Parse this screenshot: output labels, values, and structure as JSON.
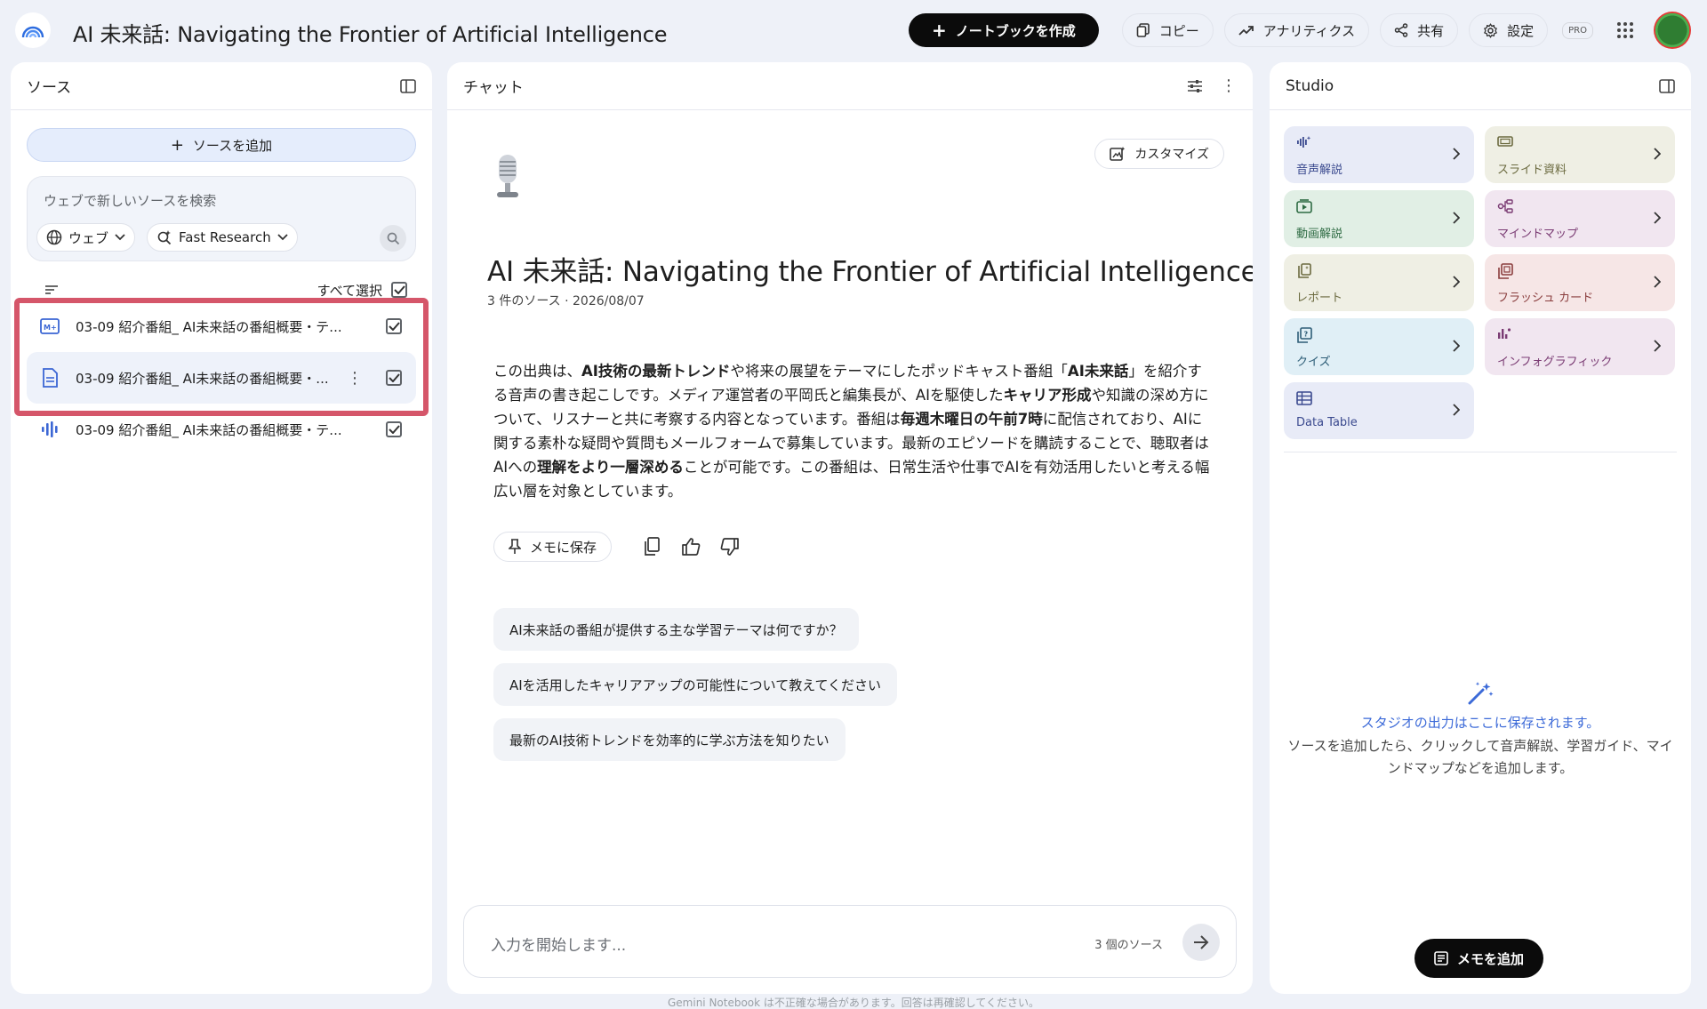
{
  "topbar": {
    "title": "AI 未来話: Navigating the Frontier of Artificial Intelligence",
    "create_label": "ノートブックを作成",
    "copy_label": "コピー",
    "analytics_label": "アナリティクス",
    "share_label": "共有",
    "settings_label": "設定",
    "pro_label": "PRO"
  },
  "sources": {
    "header": "ソース",
    "add_label": "ソースを追加",
    "search_placeholder": "ウェブで新しいソースを検索",
    "chip_web": "ウェブ",
    "chip_research": "Fast Research",
    "select_all": "すべて選択",
    "items": [
      {
        "title": "03-09 紹介番組_ AI未来話の番組概要・テ...",
        "icon": "markdown-icon"
      },
      {
        "title": "03-09 紹介番組_ AI未来話の番組概要・...",
        "icon": "document-icon"
      },
      {
        "title": "03-09 紹介番組_ AI未来話の番組概要・テ...",
        "icon": "audio-icon"
      }
    ]
  },
  "chat": {
    "header": "チャット",
    "customize_label": "カスタマイズ",
    "title": "AI 未来話: Navigating the Frontier of Artificial Intelligence",
    "meta": "3 件のソース · 2026/08/07",
    "summary": [
      {
        "t": "この出典は、",
        "b": false
      },
      {
        "t": "AI技術の最新トレンド",
        "b": true
      },
      {
        "t": "や将来の展望をテーマにしたポッドキャスト番組「",
        "b": false
      },
      {
        "t": "AI未来話",
        "b": true
      },
      {
        "t": "」を紹介する音声の書き起こしです。メディア運営者の平岡氏と編集長が、AIを駆使した",
        "b": false
      },
      {
        "t": "キャリア形成",
        "b": true
      },
      {
        "t": "や知識の深め方について、リスナーと共に考察する内容となっています。番組は",
        "b": false
      },
      {
        "t": "毎週木曜日の午前7時",
        "b": true
      },
      {
        "t": "に配信されており、AIに関する素朴な疑問や質問もメールフォームで募集しています。最新のエピソードを購読することで、聴取者はAIへの",
        "b": false
      },
      {
        "t": "理解をより一層深める",
        "b": true
      },
      {
        "t": "ことが可能です。この番組は、日常生活や仕事でAIを有効活用したいと考える幅広い層を対象としています。",
        "b": false
      }
    ],
    "save_memo_label": "メモに保存",
    "suggestions": [
      "AI未来話の番組が提供する主な学習テーマは何ですか？",
      "AIを活用したキャリアアップの可能性について教えてください",
      "最新のAI技術トレンドを効率的に学ぶ方法を知りたい"
    ],
    "input_placeholder": "入力を開始します...",
    "source_count": "3 個のソース"
  },
  "studio": {
    "header": "Studio",
    "tiles": [
      {
        "label": "音声解説",
        "bg": "#e8ebf7",
        "fg": "#3b4a8f",
        "icon": "audio-overview-icon"
      },
      {
        "label": "スライド資料",
        "bg": "#efefe4",
        "fg": "#6b6a3f",
        "icon": "slides-icon"
      },
      {
        "label": "動画解説",
        "bg": "#e1efe5",
        "fg": "#2e6b43",
        "icon": "video-overview-icon"
      },
      {
        "label": "マインドマップ",
        "bg": "#f1e6f0",
        "fg": "#7a3b73",
        "icon": "mindmap-icon"
      },
      {
        "label": "レポート",
        "bg": "#efefe4",
        "fg": "#6b6a3f",
        "icon": "report-icon"
      },
      {
        "label": "フラッシュ カード",
        "bg": "#f6e6e6",
        "fg": "#8a3d3d",
        "icon": "flashcards-icon"
      },
      {
        "label": "クイズ",
        "bg": "#e0eff6",
        "fg": "#2d5d77",
        "icon": "quiz-icon"
      },
      {
        "label": "インフォグラフィック",
        "bg": "#f1e6f0",
        "fg": "#7a3b73",
        "icon": "infographic-icon"
      },
      {
        "label": "Data Table",
        "bg": "#e8ebf7",
        "fg": "#3b4a8f",
        "icon": "data-table-icon"
      }
    ],
    "empty_title": "スタジオの出力はここに保存されます。",
    "empty_desc": "ソースを追加したら、クリックして音声解説、学習ガイド、マインドマップなどを追加します。",
    "add_memo_label": "メモを追加"
  },
  "footer": "Gemini Notebook は不正確な場合があります。回答は再確認してください。"
}
